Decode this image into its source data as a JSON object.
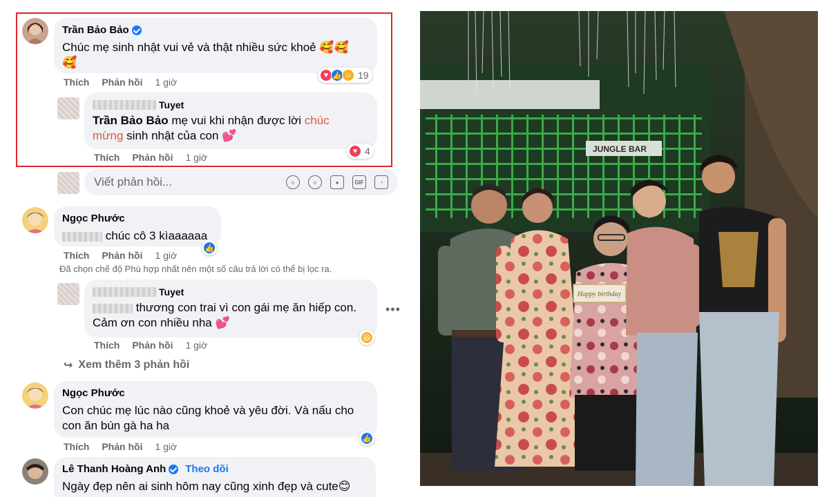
{
  "comments": [
    {
      "author": "Trần Bảo Bảo",
      "verified": true,
      "text": "Chúc mẹ sinh nhật vui vẻ và thật nhiều sức khoẻ 🥰🥰",
      "text_line2": "🥰",
      "like": "Thích",
      "reply": "Phản hồi",
      "time": "1 giờ",
      "reaction_count": "19",
      "reply_item": {
        "author": "Tuyet",
        "mention": "Trần Bảo Bảo",
        "text_a": " mẹ vui khi nhận được lời ",
        "tag_a": "chúc",
        "tag_b": "mừng",
        "text_b": " sinh nhật của con 💕",
        "like": "Thích",
        "reply": "Phản hồi",
        "time": "1 giờ",
        "reaction_count": "4"
      }
    },
    {
      "author": "Ngọc Phước",
      "text": "chúc cô 3 kìaaaaaa",
      "like": "Thích",
      "reply": "Phản hồi",
      "time": "1 giờ",
      "reply_item": {
        "author": "Tuyet",
        "text_a": "thương con trai vì con gái mẹ ăn hiếp con.",
        "text_b": "Cảm ơn con nhiều nha 💕",
        "like": "Thích",
        "reply": "Phản hồi",
        "time": "1 giờ"
      }
    },
    {
      "author": "Ngọc Phước",
      "text_a": "Con chúc mẹ lúc nào cũng khoẻ và yêu đời. Và nấu cho",
      "text_b": "con ăn bún gà ha ha",
      "like": "Thích",
      "reply": "Phản hồi",
      "time": "1 giờ"
    },
    {
      "author": "Lê Thanh Hoàng Anh",
      "verified": true,
      "follow": "Theo dõi",
      "text": "Ngày đẹp nên ai sinh hôm nay cũng xinh đẹp và cute😊"
    }
  ],
  "reply_input": {
    "placeholder": "Viết phản hồi..."
  },
  "filter_note": "Đã chọn chế độ Phù hợp nhất nên một số câu trả lời có thể bị lọc ra.",
  "see_more": "Xem thêm 3 phản hồi",
  "input_icons": [
    "sticker-icon",
    "emoji-icon",
    "camera-icon",
    "gif-icon",
    "avatar-sticker-icon"
  ],
  "photo": {
    "card_text": "Happy birthday",
    "sign_text": "JUNGLE BAR"
  },
  "colors": {
    "highlight_border": "#e0242b",
    "bubble_bg": "#f0f2f5",
    "tag_color": "#e0583a",
    "link_blue": "#1877f2",
    "muted": "#65676b"
  }
}
